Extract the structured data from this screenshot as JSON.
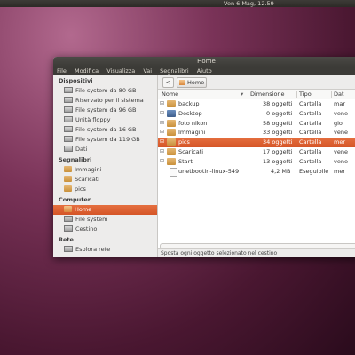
{
  "topbar": {
    "clock": "Ven  6 Mag, 12.59"
  },
  "window": {
    "title": "Home",
    "menu": [
      "File",
      "Modifica",
      "Visualizza",
      "Vai",
      "Segnalibri",
      "Aiuto"
    ]
  },
  "sidebar": {
    "devices_header": "Dispositivi",
    "devices": [
      "File system da 80 GB",
      "Riservato per il sistema",
      "File system da 96 GB",
      "Unità floppy",
      "File system da 16 GB",
      "File system da 119 GB",
      "Dati"
    ],
    "bookmarks_header": "Segnalibri",
    "bookmarks": [
      "Immagini",
      "Scaricati",
      "pics"
    ],
    "computer_header": "Computer",
    "computer": [
      "Home",
      "File system",
      "Cestino"
    ],
    "network_header": "Rete",
    "network_partial": "Esplora rete"
  },
  "pathbar": {
    "back_icon": "chevron-left-icon",
    "back_glyph": "<",
    "home_label": "Home"
  },
  "table": {
    "columns": [
      "Nome",
      "Dimensione",
      "Tipo",
      "Dat"
    ],
    "sort_indicator": "▾",
    "rows": [
      {
        "expander": "⊞",
        "icon": "folder",
        "name": "backup",
        "size": "38 oggetti",
        "type": "Cartella",
        "mod": "mar"
      },
      {
        "expander": "⊞",
        "icon": "desktop",
        "name": "Desktop",
        "size": "0 oggetti",
        "type": "Cartella",
        "mod": "vene"
      },
      {
        "expander": "⊞",
        "icon": "folder",
        "name": "foto nikon",
        "size": "58 oggetti",
        "type": "Cartella",
        "mod": "gio"
      },
      {
        "expander": "⊞",
        "icon": "folder",
        "name": "Immagini",
        "size": "33 oggetti",
        "type": "Cartella",
        "mod": "vene"
      },
      {
        "expander": "⊞",
        "icon": "folder",
        "name": "pics",
        "size": "34 oggetti",
        "type": "Cartella",
        "mod": "mer"
      },
      {
        "expander": "⊞",
        "icon": "folder",
        "name": "Scaricati",
        "size": "17 oggetti",
        "type": "Cartella",
        "mod": "vene"
      },
      {
        "expander": "⊞",
        "icon": "folder",
        "name": "Start",
        "size": "13 oggetti",
        "type": "Cartella",
        "mod": "vene"
      },
      {
        "expander": "",
        "icon": "file",
        "name": "unetbootin-linux-549",
        "size": "4,2 MB",
        "type": "Eseguibile",
        "mod": "mer"
      }
    ]
  },
  "status": {
    "text": "Sposta ogni oggetto selezionato nel cestino"
  },
  "colors": {
    "accent": "#dd6432",
    "chrome": "#3c3b37",
    "background": "#5c1f3f"
  }
}
